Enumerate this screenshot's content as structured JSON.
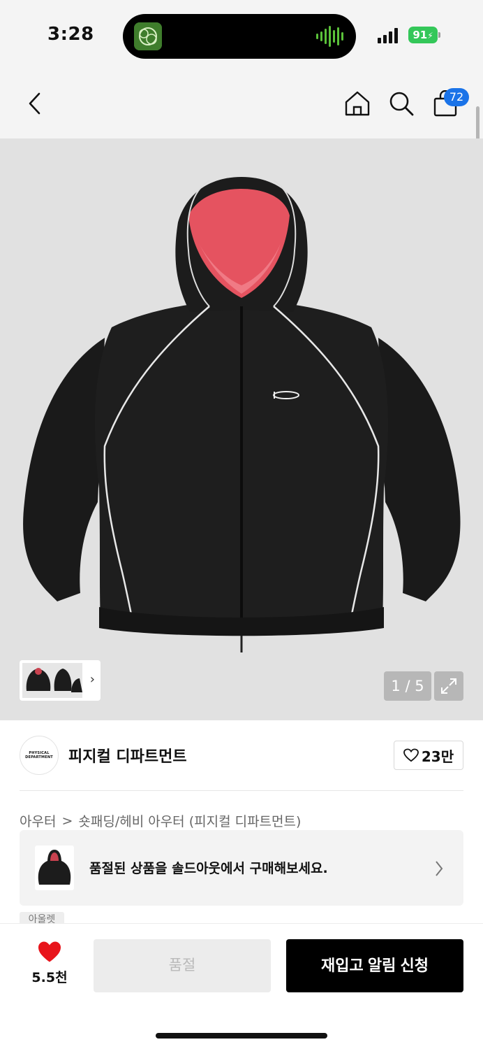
{
  "status_bar": {
    "time": "3:28",
    "battery": "91"
  },
  "nav": {
    "cart_count": "72",
    "icons": [
      "back-arrow-icon",
      "home-icon",
      "search-icon",
      "shopping-bag-icon"
    ]
  },
  "gallery": {
    "counter": "1 / 5",
    "thumb_chevron": "›"
  },
  "brand": {
    "logo_text": "PHYSICAL DEPARTMENT",
    "name": "피지컬 디파트먼트",
    "likes": "23만"
  },
  "breadcrumb": {
    "category": "아우터",
    "separator": ">",
    "subcategory": "숏패딩/헤비 아우터 (피지컬 디파트먼트)"
  },
  "soldout_banner": {
    "text": "품절된 상품을 솔드아웃에서 구매해보세요."
  },
  "partial_tag": "아울렛",
  "bottom": {
    "wish_count": "5.5천",
    "soldout_label": "품절",
    "restock_label": "재입고 알림 신청"
  },
  "colors": {
    "accent_blue": "#1a73e8",
    "heart_red": "#e8141b",
    "battery_green": "#34c759"
  }
}
